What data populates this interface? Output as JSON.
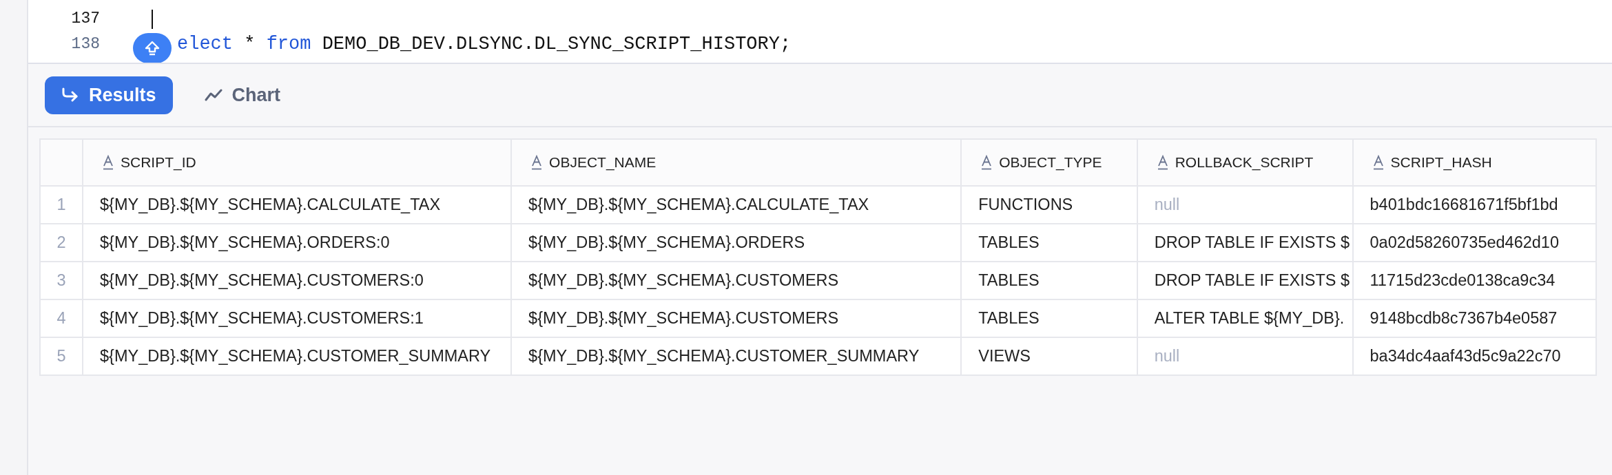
{
  "editor": {
    "lines": [
      {
        "number": "137",
        "cursor": true
      },
      {
        "number": "138",
        "cursor": false,
        "tokens": [
          {
            "text": "elect",
            "kind": "keyword"
          },
          {
            "text": " * ",
            "kind": "plain"
          },
          {
            "text": "from",
            "kind": "keyword"
          },
          {
            "text": " DEMO_DB_DEV.DLSYNC.DL_SYNC_SCRIPT_HISTORY;",
            "kind": "plain"
          }
        ]
      }
    ]
  },
  "tabs": [
    {
      "label": "Results",
      "selected": true,
      "kind": "results"
    },
    {
      "label": "Chart",
      "selected": false,
      "kind": "chart"
    }
  ],
  "table": {
    "columns": [
      "SCRIPT_ID",
      "OBJECT_NAME",
      "OBJECT_TYPE",
      "ROLLBACK_SCRIPT",
      "SCRIPT_HASH"
    ],
    "rows": [
      {
        "index": "1",
        "cells": [
          {
            "text": "${MY_DB}.${MY_SCHEMA}.CALCULATE_TAX"
          },
          {
            "text": "${MY_DB}.${MY_SCHEMA}.CALCULATE_TAX"
          },
          {
            "text": "FUNCTIONS"
          },
          {
            "text": "null",
            "null": true
          },
          {
            "text": "b401bdc16681671f5bf1bd"
          }
        ]
      },
      {
        "index": "2",
        "cells": [
          {
            "text": "${MY_DB}.${MY_SCHEMA}.ORDERS:0"
          },
          {
            "text": "${MY_DB}.${MY_SCHEMA}.ORDERS"
          },
          {
            "text": "TABLES"
          },
          {
            "text": "DROP TABLE IF EXISTS $"
          },
          {
            "text": "0a02d58260735ed462d10"
          }
        ]
      },
      {
        "index": "3",
        "cells": [
          {
            "text": "${MY_DB}.${MY_SCHEMA}.CUSTOMERS:0"
          },
          {
            "text": "${MY_DB}.${MY_SCHEMA}.CUSTOMERS"
          },
          {
            "text": "TABLES"
          },
          {
            "text": "DROP TABLE IF EXISTS $"
          },
          {
            "text": "11715d23cde0138ca9c34"
          }
        ]
      },
      {
        "index": "4",
        "cells": [
          {
            "text": "${MY_DB}.${MY_SCHEMA}.CUSTOMERS:1"
          },
          {
            "text": "${MY_DB}.${MY_SCHEMA}.CUSTOMERS"
          },
          {
            "text": "TABLES"
          },
          {
            "text": "ALTER TABLE ${MY_DB}."
          },
          {
            "text": "9148bcdb8c7367b4e0587"
          }
        ]
      },
      {
        "index": "5",
        "cells": [
          {
            "text": "${MY_DB}.${MY_SCHEMA}.CUSTOMER_SUMMARY"
          },
          {
            "text": "${MY_DB}.${MY_SCHEMA}.CUSTOMER_SUMMARY"
          },
          {
            "text": "VIEWS"
          },
          {
            "text": "null",
            "null": true
          },
          {
            "text": "ba34dc4aaf43d5c9a22c70"
          }
        ]
      }
    ]
  }
}
